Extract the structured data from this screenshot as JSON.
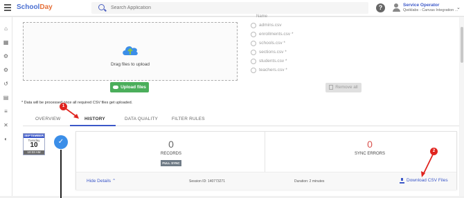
{
  "app": {
    "logo_part1": "School",
    "logo_part2": "Day"
  },
  "search": {
    "placeholder": "Search Application"
  },
  "user": {
    "name": "Service Operator",
    "org": "Qwiklabs - Canvas Integration ..."
  },
  "sidebar": {
    "icons": [
      "home-icon",
      "apps-icon",
      "settings-icon",
      "settings-alt-icon",
      "history-icon",
      "file-check-icon",
      "database-icon",
      "tools-icon",
      "shield-icon"
    ]
  },
  "upload": {
    "drop_text": "Drag files to upload",
    "upload_button": "Upload files",
    "remove_button": "Remove all",
    "note": "* Data will be processed once all required CSV files get uploaded."
  },
  "files": {
    "header": "Name",
    "items": [
      "admins.csv",
      "enrollments.csv *",
      "schools.csv *",
      "sections.csv *",
      "students.csv *",
      "teachers.csv *"
    ]
  },
  "tabs": [
    {
      "label": "OVERVIEW",
      "active": false
    },
    {
      "label": "HISTORY",
      "active": true
    },
    {
      "label": "DATA QUALITY",
      "active": false
    },
    {
      "label": "FILTER RULES",
      "active": false
    }
  ],
  "history": {
    "calendar": {
      "month": "SEPTEMBER",
      "weekday": "Tuesday",
      "day": "10",
      "time": "10:33 AM"
    },
    "records": {
      "value": "0",
      "label": "RECORDS",
      "tag": "FULL SYNC"
    },
    "sync_errors": {
      "value": "0",
      "label": "SYNC ERRORS"
    },
    "footer": {
      "hide_details": "Hide Details",
      "session": "Session ID: 140773271",
      "duration": "Duration: 2 minutes",
      "download": "Download CSV Files"
    }
  },
  "annotations": {
    "badge1": "1",
    "badge2": "2"
  },
  "colors": {
    "accent": "#3b57c8",
    "success": "#4bae5b",
    "error": "#d9534f",
    "badge": "#e0241f"
  }
}
